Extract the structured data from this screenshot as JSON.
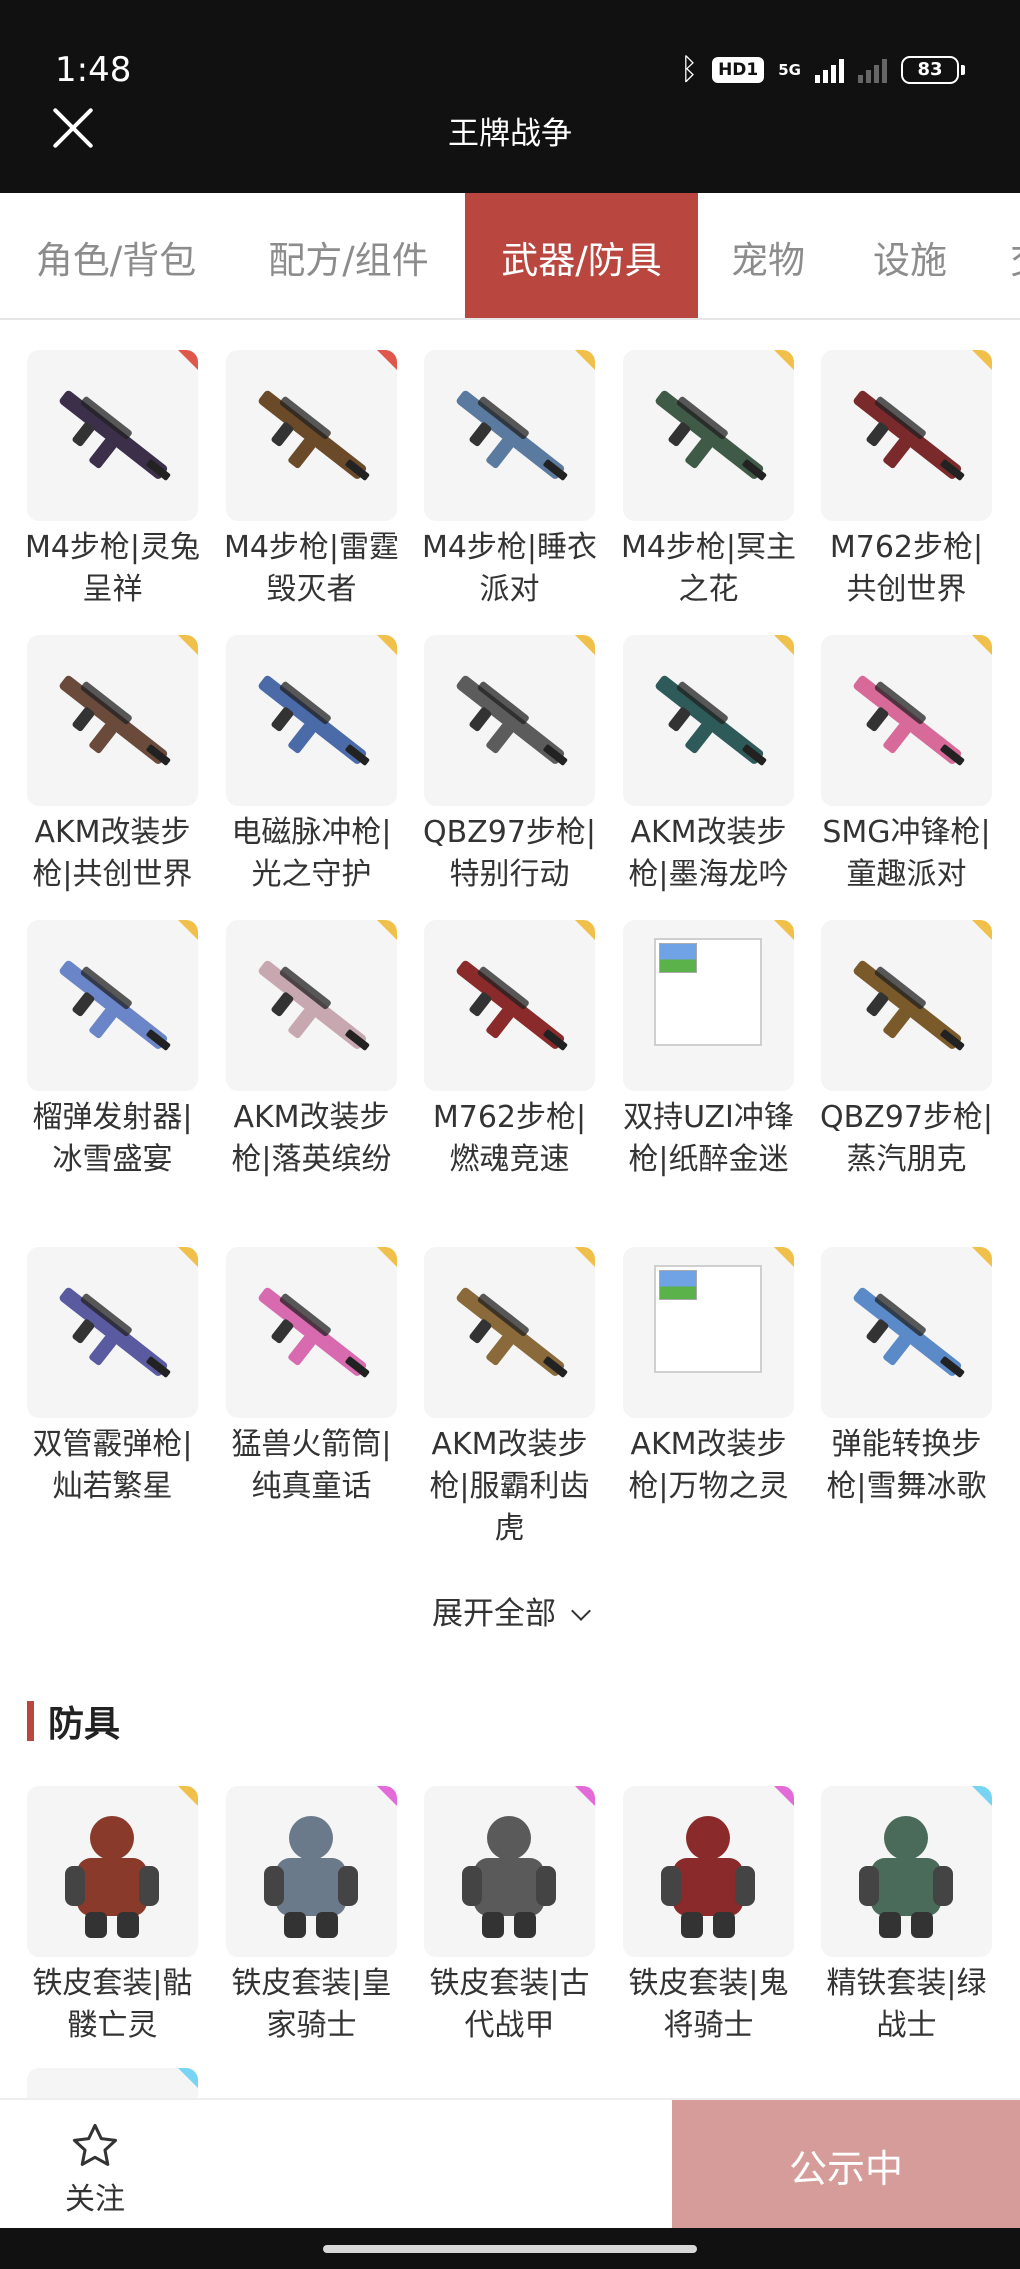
{
  "status_bar": {
    "time": "1:48",
    "hd_badge": "HD1",
    "network": "5G",
    "battery": "83"
  },
  "header": {
    "title": "王牌战争"
  },
  "tabs": [
    {
      "label": "角色/背包",
      "active": false
    },
    {
      "label": "配方/组件",
      "active": false
    },
    {
      "label": "武器/防具",
      "active": true
    },
    {
      "label": "宠物",
      "active": false
    },
    {
      "label": "设施",
      "active": false
    },
    {
      "label": "交",
      "active": false
    }
  ],
  "weapons": [
    {
      "name": "M4步枪|灵兔呈祥",
      "rarity_color": "#e0584c",
      "icon": "rifle-dark-purple-icon"
    },
    {
      "name": "M4步枪|雷霆毁灭者",
      "rarity_color": "#e0584c",
      "icon": "rifle-orange-icon"
    },
    {
      "name": "M4步枪|睡衣派对",
      "rarity_color": "#f0c04a",
      "icon": "rifle-pink-blue-icon"
    },
    {
      "name": "M4步枪|冥主之花",
      "rarity_color": "#f0c04a",
      "icon": "rifle-green-icon"
    },
    {
      "name": "M762步枪|共创世界",
      "rarity_color": "#f0c04a",
      "icon": "rifle-red-icon"
    },
    {
      "name": "AKM改装步枪|共创世界",
      "rarity_color": "#f0c04a",
      "icon": "rifle-brown-icon"
    },
    {
      "name": "电磁脉冲枪|光之守护",
      "rarity_color": "#f0c04a",
      "icon": "pulse-gun-blue-icon"
    },
    {
      "name": "QBZ97步枪|特别行动",
      "rarity_color": "#f0c04a",
      "icon": "rifle-grey-icon"
    },
    {
      "name": "AKM改装步枪|墨海龙吟",
      "rarity_color": "#f0c04a",
      "icon": "rifle-teal-icon"
    },
    {
      "name": "SMG冲锋枪|童趣派对",
      "rarity_color": "#f0c04a",
      "icon": "smg-colorful-icon"
    },
    {
      "name": "榴弹发射器|冰雪盛宴",
      "rarity_color": "#f0c04a",
      "icon": "grenade-launcher-blue-icon"
    },
    {
      "name": "AKM改装步枪|落英缤纷",
      "rarity_color": "#f0c04a",
      "icon": "rifle-white-pink-icon"
    },
    {
      "name": "M762步枪|燃魂竞速",
      "rarity_color": "#f0c04a",
      "icon": "rifle-crimson-icon"
    },
    {
      "name": "双持UZI冲锋枪|纸醉金迷",
      "rarity_color": "#f0c04a",
      "icon": "broken-image-icon"
    },
    {
      "name": "QBZ97步枪|蒸汽朋克",
      "rarity_color": "#f0c04a",
      "icon": "rifle-bronze-icon"
    },
    {
      "name": "双管霰弹枪|灿若繁星",
      "rarity_color": "#f0c04a",
      "icon": "shotgun-purple-icon"
    },
    {
      "name": "猛兽火箭筒|纯真童话",
      "rarity_color": "#f0c04a",
      "icon": "rocket-launcher-pink-icon"
    },
    {
      "name": "AKM改装步枪|服霸利齿虎",
      "rarity_color": "#f0c04a",
      "icon": "rifle-tiger-icon"
    },
    {
      "name": "AKM改装步枪|万物之灵",
      "rarity_color": "#f0c04a",
      "icon": "broken-image-icon"
    },
    {
      "name": "弹能转换步枪|雪舞冰歌",
      "rarity_color": "#f0c04a",
      "icon": "rifle-ice-icon"
    }
  ],
  "expand_label": "展开全部",
  "armor_section": {
    "title": "防具",
    "items": [
      {
        "name": "铁皮套装|骷髅亡灵",
        "rarity_color": "#f0c04a",
        "icon": "armor-skeleton-icon"
      },
      {
        "name": "铁皮套装|皇家骑士",
        "rarity_color": "#e36ad9",
        "icon": "armor-royal-knight-icon"
      },
      {
        "name": "铁皮套装|古代战甲",
        "rarity_color": "#e36ad9",
        "icon": "armor-ancient-icon"
      },
      {
        "name": "铁皮套装|鬼将骑士",
        "rarity_color": "#e36ad9",
        "icon": "armor-ghost-knight-icon"
      },
      {
        "name": "精铁套装|绿战士",
        "rarity_color": "#79d4f4",
        "icon": "armor-green-warrior-icon"
      }
    ],
    "partial_item_rarity_color": "#79d4f4"
  },
  "bottom_bar": {
    "follow_label": "关注",
    "publish_label": "公示中"
  }
}
